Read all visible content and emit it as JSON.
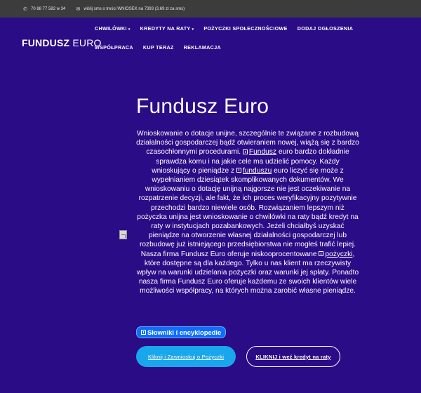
{
  "topbar": {
    "phone": "70 88 77 582 w 34",
    "sms": "wiślij sms o treści WNIOSEK na 7393 (3.69 zł za sms)"
  },
  "header": {
    "logo_bold": "FUNDUSZ",
    "logo_light": "EURO",
    "nav": [
      {
        "label": "CHWILÓWKI",
        "caret": "▾"
      },
      {
        "label": "KREDYTY NA RATY",
        "caret": "▾"
      },
      {
        "label": "POŻYCZKI SPOŁECZNOŚCIOWE",
        "caret": ""
      },
      {
        "label": "DODAJ OGŁOSZENIA",
        "caret": ""
      },
      {
        "label": "WSPÓŁPRACA",
        "caret": ""
      },
      {
        "label": "KUP TERAZ",
        "caret": ""
      },
      {
        "label": "REKLAMACJA",
        "caret": ""
      }
    ]
  },
  "hero": {
    "title": "Fundusz Euro",
    "p_part1": "Wnioskowanie o dotacje unijne, szczególnie te związane z rozbudową działalności gospodarczej bądź otwieraniem nowej, wiążą się z bardzo czasochłonnymi procedurami. ",
    "link1": "Fundusz",
    "p_part2": " euro bardzo dokładnie sprawdza komu i na jakie cele ma udzielić pomocy. Każdy wnioskujący o pieniądze z ",
    "link2": "funduszu",
    "p_part3": " euro liczyć się może z wypełnianiem dziesiątek skomplikowanych dokumentów. We wnioskowaniu o dotację unijną najgorsze nie jest oczekiwanie na rozpatrzenie decyzji, ale fakt, że ich proces weryfikacyjny pozytywnie przechodzi bardzo niewiele osób. Rozwiązaniem lepszym niż pożyczka unijna jest wnioskowanie o chwilówki na raty bądź kredyt na raty w instytucjach pozabankowych. Jeżeli chciałbyś uzyskać pieniądze na otworzenie własnej działalności gospodarczej lub rozbudowę już istniejącego przedsiębiorstwa nie mogłeś trafić lepiej. Nasza firma Fundusz Euro oferuje niskooprocentowane ",
    "link3": "pożyczki",
    "p_part4": ", które dostępne są dla każdego. Tylko u nas klient ma rzeczywisty wpływ na warunki udzielania pożyczki oraz warunki jej spłaty. Ponadto nasza firma Fundusz Euro oferuje każdemu ze swoich klientów wiele możliwości współpracy, na których można zarobić własne pieniądze.",
    "dict_badge": "Słowniki i encyklopedie",
    "btn_primary": "Kliknij i Zawnioskuj o Pożyczki",
    "btn_outline": "KLIKNIJ i weź kredyt na raty"
  },
  "icons": {
    "phone": "phone-icon",
    "envelope": "envelope-icon",
    "book": "book-icon",
    "broken_image": "broken-image-icon"
  },
  "colors": {
    "background": "#2a0c86",
    "topbar": "#3c3c3c",
    "primary_button": "#1aa6ec",
    "badge": "#0d6efd"
  }
}
